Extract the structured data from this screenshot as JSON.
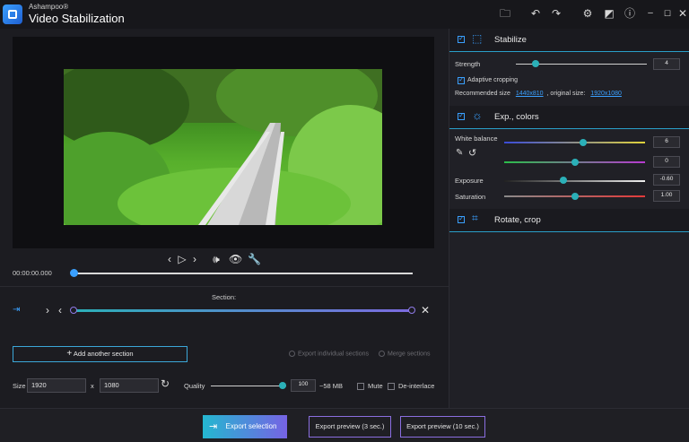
{
  "app": {
    "vendor": "Ashampoo®",
    "title": "Video Stabilization"
  },
  "titlebar_icons": [
    "folder-icon",
    "undo-icon",
    "redo-icon",
    "settings-icon",
    "compare-icon",
    "info-icon",
    "minimize-icon",
    "maximize-icon",
    "close-icon"
  ],
  "player": {
    "time": "00:00:00.000",
    "position": 0.0
  },
  "section": {
    "label": "Section:"
  },
  "actions": {
    "add_section": "Add another section",
    "export_individual": "Export individual sections",
    "merge_sections": "Merge sections"
  },
  "size": {
    "label": "Size",
    "width": "1920",
    "x": "x",
    "height": "1080",
    "quality_label": "Quality",
    "quality_value": "100",
    "quality_fraction": 0.95,
    "estimate": "~58 MB",
    "mute": "Mute",
    "deinterlace": "De-interlace"
  },
  "stabilize": {
    "title": "Stabilize",
    "strength_label": "Strength",
    "strength_value": "4",
    "strength_fraction": 0.15,
    "adaptive_cropping": "Adaptive cropping",
    "recommended_label": "Recommended size",
    "recommended_value": "1440x810",
    "original_label": ", original size:",
    "original_value": "1920x1080"
  },
  "colors": {
    "title": "Exp., colors",
    "white_balance_label": "White balance",
    "wb1_value": "6",
    "wb1_fraction": 0.56,
    "wb2_value": "0",
    "wb2_fraction": 0.5,
    "exposure_label": "Exposure",
    "exposure_value": "-0.60",
    "exposure_fraction": 0.42,
    "saturation_label": "Saturation",
    "saturation_value": "1.00",
    "saturation_fraction": 0.5
  },
  "rotate": {
    "title": "Rotate, crop"
  },
  "bottom": {
    "export_selection": "Export selection",
    "preview3": "Export preview (3 sec.)",
    "preview10": "Export preview (10 sec.)"
  },
  "colors_theme": {
    "accent": "#3aa0ff",
    "teal": "#2bb0b8",
    "violet": "#7c6ae0"
  }
}
